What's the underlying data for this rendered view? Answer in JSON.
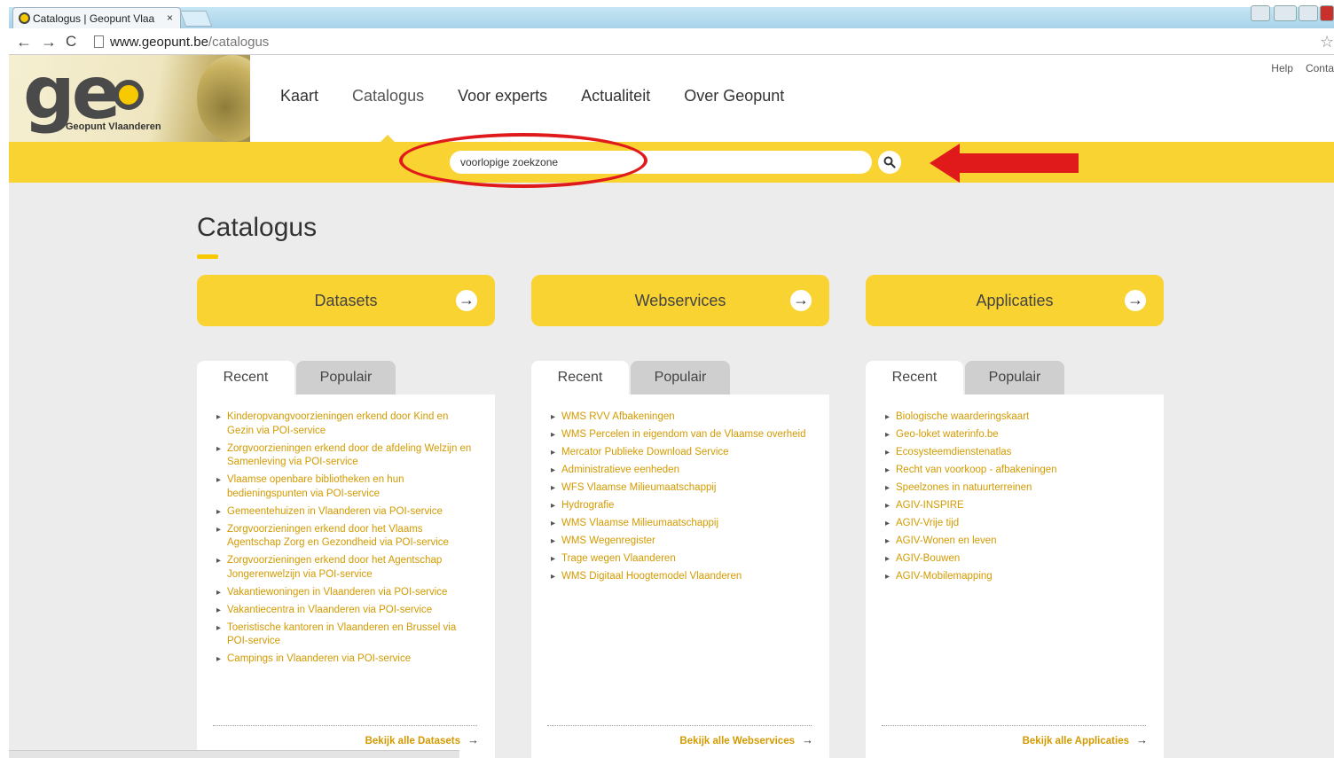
{
  "browser": {
    "tab_title": "Catalogus | Geopunt Vlaa",
    "tab_close": "×",
    "url_host": "www.geopunt.be",
    "url_path": "/catalogus"
  },
  "header": {
    "logo_text": "geo",
    "logo_subtitle": "Geopunt Vlaanderen",
    "nav": [
      "Kaart",
      "Catalogus",
      "Voor experts",
      "Actualiteit",
      "Over Geopunt"
    ],
    "active_nav": "Catalogus",
    "toplinks": [
      "Help",
      "Conta"
    ]
  },
  "search": {
    "value": "voorlopige zoekzone"
  },
  "main": {
    "title": "Catalogus",
    "sections": [
      {
        "button": "Datasets",
        "tabs": [
          "Recent",
          "Populair"
        ],
        "items": [
          "Kinderopvangvoorzieningen erkend door Kind en Gezin via POI-service",
          "Zorgvoorzieningen erkend door de afdeling Welzijn en Samenleving via POI-service",
          "Vlaamse openbare bibliotheken en hun bedieningspunten via POI-service",
          "Gemeentehuizen in Vlaanderen via POI-service",
          "Zorgvoorzieningen erkend door het Vlaams Agentschap Zorg en Gezondheid via POI-service",
          "Zorgvoorzieningen erkend door het Agentschap Jongerenwelzijn via POI-service",
          "Vakantiewoningen in Vlaanderen via POI-service",
          "Vakantiecentra in Vlaanderen via POI-service",
          "Toeristische kantoren in Vlaanderen en Brussel via POI-service",
          "Campings in Vlaanderen via POI-service"
        ],
        "see_all": "Bekijk alle Datasets"
      },
      {
        "button": "Webservices",
        "tabs": [
          "Recent",
          "Populair"
        ],
        "items": [
          "WMS RVV Afbakeningen",
          "WMS Percelen in eigendom van de Vlaamse overheid",
          "Mercator Publieke Download Service",
          "Administratieve eenheden",
          "WFS Vlaamse Milieumaatschappij",
          "Hydrografie",
          "WMS Vlaamse Milieumaatschappij",
          "WMS Wegenregister",
          "Trage wegen Vlaanderen",
          "WMS Digitaal Hoogtemodel Vlaanderen"
        ],
        "see_all": "Bekijk alle Webservices"
      },
      {
        "button": "Applicaties",
        "tabs": [
          "Recent",
          "Populair"
        ],
        "items": [
          "Biologische waarderingskaart",
          "Geo-loket waterinfo.be",
          "Ecosysteemdienstenatlas",
          "Recht van voorkoop - afbakeningen",
          "Speelzones in natuurterreinen",
          "AGIV-INSPIRE",
          "AGIV-Vrije tijd",
          "AGIV-Wonen en leven",
          "AGIV-Bouwen",
          "AGIV-Mobilemapping"
        ],
        "see_all": "Bekijk alle Applicaties"
      }
    ]
  },
  "colors": {
    "accent_yellow": "#f9d331",
    "link_color": "#d39a00",
    "annotation_red": "#e0191b"
  },
  "icons": {
    "search": "search-icon",
    "arrow_right": "arrow-right-icon",
    "star": "star-icon"
  },
  "arrow_glyph": "→",
  "list_arrow_glyph": "→"
}
